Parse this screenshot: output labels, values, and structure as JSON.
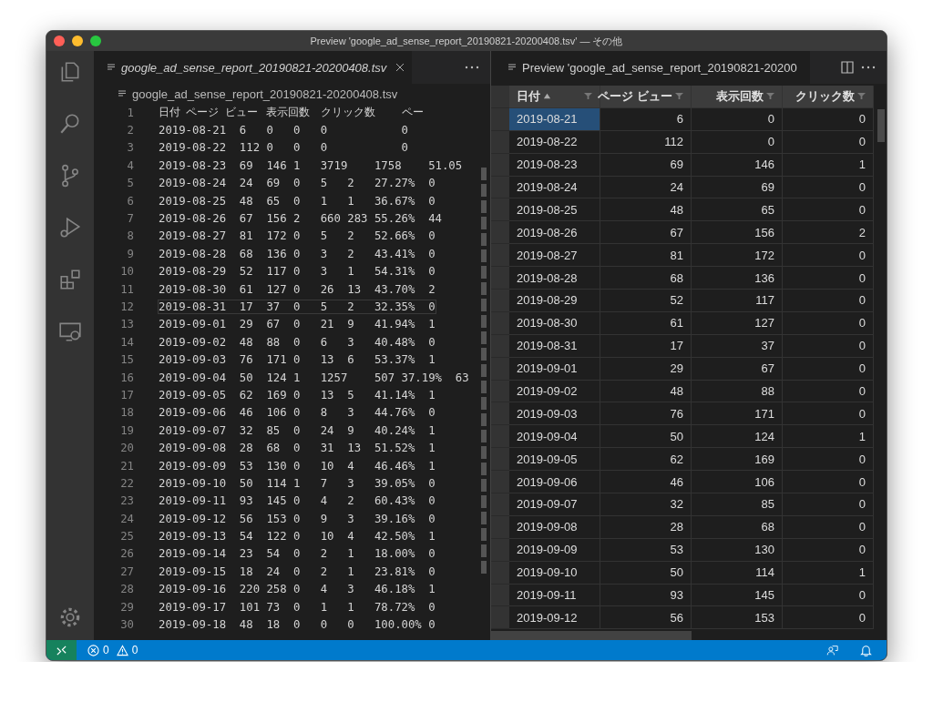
{
  "window": {
    "title": "Preview 'google_ad_sense_report_20190821-20200408.tsv' — その他"
  },
  "editor": {
    "tab": {
      "label": "google_ad_sense_report_20190821-20200408.tsv"
    },
    "breadcrumb": "google_ad_sense_report_20190821-20200408.tsv",
    "lines": [
      {
        "number": "1",
        "text": "日付\tページ ビュー\t表示回数\tクリック数\tペー",
        "current": false
      },
      {
        "number": "2",
        "text": "2019-08-21\t6\t0\t0\t0\t\t\t0",
        "current": false
      },
      {
        "number": "3",
        "text": "2019-08-22\t112\t0\t0\t0\t\t\t0",
        "current": false
      },
      {
        "number": "4",
        "text": "2019-08-23\t69\t146\t1\t3719\t1758\t51.05",
        "current": false
      },
      {
        "number": "5",
        "text": "2019-08-24\t24\t69\t0\t5\t2\t27.27%\t0",
        "current": false
      },
      {
        "number": "6",
        "text": "2019-08-25\t48\t65\t0\t1\t1\t36.67%\t0",
        "current": false
      },
      {
        "number": "7",
        "text": "2019-08-26\t67\t156\t2\t660\t283\t55.26%\t44",
        "current": false
      },
      {
        "number": "8",
        "text": "2019-08-27\t81\t172\t0\t5\t2\t52.66%\t0",
        "current": false
      },
      {
        "number": "9",
        "text": "2019-08-28\t68\t136\t0\t3\t2\t43.41%\t0",
        "current": false
      },
      {
        "number": "10",
        "text": "2019-08-29\t52\t117\t0\t3\t1\t54.31%\t0",
        "current": false
      },
      {
        "number": "11",
        "text": "2019-08-30\t61\t127\t0\t26\t13\t43.70%\t2",
        "current": false
      },
      {
        "number": "12",
        "text": "2019-08-31\t17\t37\t0\t5\t2\t32.35%\t0",
        "current": true
      },
      {
        "number": "13",
        "text": "2019-09-01\t29\t67\t0\t21\t9\t41.94%\t1",
        "current": false
      },
      {
        "number": "14",
        "text": "2019-09-02\t48\t88\t0\t6\t3\t40.48%\t0",
        "current": false
      },
      {
        "number": "15",
        "text": "2019-09-03\t76\t171\t0\t13\t6\t53.37%\t1",
        "current": false
      },
      {
        "number": "16",
        "text": "2019-09-04\t50\t124\t1\t1257\t507\t37.19%\t63",
        "current": false
      },
      {
        "number": "17",
        "text": "2019-09-05\t62\t169\t0\t13\t5\t41.14%\t1",
        "current": false
      },
      {
        "number": "18",
        "text": "2019-09-06\t46\t106\t0\t8\t3\t44.76%\t0",
        "current": false
      },
      {
        "number": "19",
        "text": "2019-09-07\t32\t85\t0\t24\t9\t40.24%\t1",
        "current": false
      },
      {
        "number": "20",
        "text": "2019-09-08\t28\t68\t0\t31\t13\t51.52%\t1",
        "current": false
      },
      {
        "number": "21",
        "text": "2019-09-09\t53\t130\t0\t10\t4\t46.46%\t1",
        "current": false
      },
      {
        "number": "22",
        "text": "2019-09-10\t50\t114\t1\t7\t3\t39.05%\t0",
        "current": false
      },
      {
        "number": "23",
        "text": "2019-09-11\t93\t145\t0\t4\t2\t60.43%\t0",
        "current": false
      },
      {
        "number": "24",
        "text": "2019-09-12\t56\t153\t0\t9\t3\t39.16%\t0",
        "current": false
      },
      {
        "number": "25",
        "text": "2019-09-13\t54\t122\t0\t10\t4\t42.50%\t1",
        "current": false
      },
      {
        "number": "26",
        "text": "2019-09-14\t23\t54\t0\t2\t1\t18.00%\t0",
        "current": false
      },
      {
        "number": "27",
        "text": "2019-09-15\t18\t24\t0\t2\t1\t23.81%\t0",
        "current": false
      },
      {
        "number": "28",
        "text": "2019-09-16\t220\t258\t0\t4\t3\t46.18%\t1",
        "current": false
      },
      {
        "number": "29",
        "text": "2019-09-17\t101\t73\t0\t1\t1\t78.72%\t0",
        "current": false
      },
      {
        "number": "30",
        "text": "2019-09-18\t48\t18\t0\t0\t0\t100.00%\t0",
        "current": false
      }
    ]
  },
  "preview": {
    "tab": {
      "label": "Preview 'google_ad_sense_report_20190821-20200"
    },
    "table": {
      "columns": [
        {
          "label": "日付",
          "kind": "date",
          "sorted": true
        },
        {
          "label": "ページ ビュー",
          "kind": "number",
          "sorted": false
        },
        {
          "label": "表示回数",
          "kind": "number",
          "sorted": false
        },
        {
          "label": "クリック数",
          "kind": "number",
          "sorted": false
        }
      ],
      "rows": [
        {
          "cells": [
            "2019-08-21",
            "6",
            "0",
            "0"
          ],
          "selected": true
        },
        {
          "cells": [
            "2019-08-22",
            "112",
            "0",
            "0"
          ],
          "selected": false
        },
        {
          "cells": [
            "2019-08-23",
            "69",
            "146",
            "1"
          ],
          "selected": false
        },
        {
          "cells": [
            "2019-08-24",
            "24",
            "69",
            "0"
          ],
          "selected": false
        },
        {
          "cells": [
            "2019-08-25",
            "48",
            "65",
            "0"
          ],
          "selected": false
        },
        {
          "cells": [
            "2019-08-26",
            "67",
            "156",
            "2"
          ],
          "selected": false
        },
        {
          "cells": [
            "2019-08-27",
            "81",
            "172",
            "0"
          ],
          "selected": false
        },
        {
          "cells": [
            "2019-08-28",
            "68",
            "136",
            "0"
          ],
          "selected": false
        },
        {
          "cells": [
            "2019-08-29",
            "52",
            "117",
            "0"
          ],
          "selected": false
        },
        {
          "cells": [
            "2019-08-30",
            "61",
            "127",
            "0"
          ],
          "selected": false
        },
        {
          "cells": [
            "2019-08-31",
            "17",
            "37",
            "0"
          ],
          "selected": false
        },
        {
          "cells": [
            "2019-09-01",
            "29",
            "67",
            "0"
          ],
          "selected": false
        },
        {
          "cells": [
            "2019-09-02",
            "48",
            "88",
            "0"
          ],
          "selected": false
        },
        {
          "cells": [
            "2019-09-03",
            "76",
            "171",
            "0"
          ],
          "selected": false
        },
        {
          "cells": [
            "2019-09-04",
            "50",
            "124",
            "1"
          ],
          "selected": false
        },
        {
          "cells": [
            "2019-09-05",
            "62",
            "169",
            "0"
          ],
          "selected": false
        },
        {
          "cells": [
            "2019-09-06",
            "46",
            "106",
            "0"
          ],
          "selected": false
        },
        {
          "cells": [
            "2019-09-07",
            "32",
            "85",
            "0"
          ],
          "selected": false
        },
        {
          "cells": [
            "2019-09-08",
            "28",
            "68",
            "0"
          ],
          "selected": false
        },
        {
          "cells": [
            "2019-09-09",
            "53",
            "130",
            "0"
          ],
          "selected": false
        },
        {
          "cells": [
            "2019-09-10",
            "50",
            "114",
            "1"
          ],
          "selected": false
        },
        {
          "cells": [
            "2019-09-11",
            "93",
            "145",
            "0"
          ],
          "selected": false
        },
        {
          "cells": [
            "2019-09-12",
            "56",
            "153",
            "0"
          ],
          "selected": false
        }
      ]
    }
  },
  "status_bar": {
    "errors": "0",
    "warnings": "0"
  }
}
